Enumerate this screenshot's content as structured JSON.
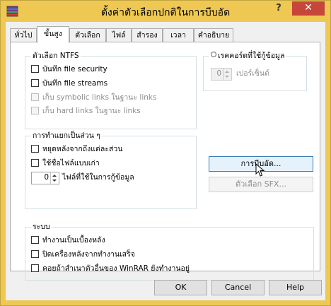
{
  "window": {
    "title": "ตั้งค่าตัวเลือกปกติในการบีบอัด",
    "help_label": "?",
    "close_label": "✕"
  },
  "tabs": [
    "ทั่วไป",
    "ขั้นสูง",
    "ตัวเลือก",
    "ไฟล์",
    "สำรอง",
    "เวลา",
    "คำอธิบาย"
  ],
  "ntfs": {
    "title": "ตัวเลือก NTFS",
    "items": [
      "บันทึก file security",
      "บันทึก file streams",
      "เก็บ symbolic links ในฐานะ links",
      "เก็บ hard links ในฐานะ links"
    ]
  },
  "recovery": {
    "title": "เรคคอร์ดที่ใช้กู้ข้อมูล",
    "value": "0",
    "unit": "เปอร์เซ็นต์"
  },
  "split": {
    "title": "การทำแยกเป็นส่วน ๆ",
    "items": [
      "หยุดหลังจากถึงแต่ละส่วน",
      "ใช้ชื่อไฟล์แบบเก่า"
    ],
    "spin_value": "0",
    "spin_label": "ไฟล์ที่ใช้ในการกู้ข้อมูล"
  },
  "buttons": {
    "compression": "การบีบอัด...",
    "sfx": "ตัวเลือก SFX...",
    "ok": "OK",
    "cancel": "Cancel",
    "help": "Help"
  },
  "system": {
    "title": "ระบบ",
    "items": [
      "ทำงานเป็นเบื้องหลัง",
      "ปิดเครื่องหลังจากทำงานเสร็จ",
      "คอยถ้าสำเนาตัวอื่นของ WinRAR ยังทำงานอยู่"
    ]
  }
}
